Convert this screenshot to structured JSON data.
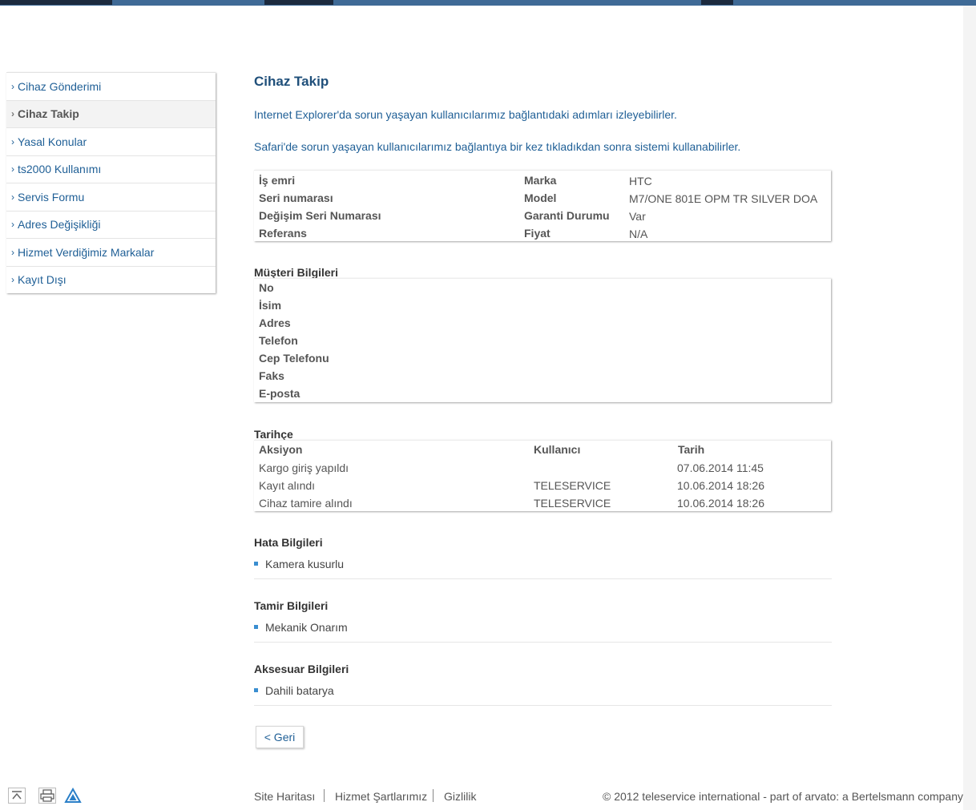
{
  "sidebar": {
    "items": [
      {
        "label": "Cihaz Gönderimi",
        "active": false
      },
      {
        "label": "Cihaz Takip",
        "active": true
      },
      {
        "label": "Yasal Konular",
        "active": false
      },
      {
        "label": "ts2000 Kullanımı",
        "active": false
      },
      {
        "label": "Servis Formu",
        "active": false
      },
      {
        "label": "Adres Değişikliği",
        "active": false
      },
      {
        "label": "Hizmet Verdiğimiz Markalar",
        "active": false
      },
      {
        "label": "Kayıt Dışı",
        "active": false
      }
    ]
  },
  "main": {
    "title": "Cihaz Takip",
    "info_ie": "Internet Explorer'da sorun yaşayan kullanıcılarımız bağlantıdaki adımları izleyebilirler.",
    "info_safari": "Safari'de sorun yaşayan kullanıcılarımız bağlantıya bir kez tıkladıkdan sonra sistemi kullanabilirler."
  },
  "order": {
    "left": [
      {
        "label": "İş emri",
        "value": ""
      },
      {
        "label": "Seri numarası",
        "value": ""
      },
      {
        "label": "Değişim Seri Numarası",
        "value": ""
      },
      {
        "label": "Referans",
        "value": ""
      }
    ],
    "right": [
      {
        "label": "Marka",
        "value": "HTC"
      },
      {
        "label": "Model",
        "value": "M7/ONE 801E OPM TR SILVER DOA"
      },
      {
        "label": "Garanti Durumu",
        "value": "Var"
      },
      {
        "label": "Fiyat",
        "value": "N/A"
      }
    ]
  },
  "customer": {
    "title": "Müşteri Bilgileri",
    "fields": [
      "No",
      "İsim",
      "Adres",
      "Telefon",
      "Cep Telefonu",
      "Faks",
      "E-posta"
    ]
  },
  "history": {
    "title": "Tarihçe",
    "headers": {
      "action": "Aksiyon",
      "user": "Kullanıcı",
      "date": "Tarih"
    },
    "rows": [
      {
        "action": "Kargo giriş yapıldı",
        "user": "",
        "date": "07.06.2014 11:45"
      },
      {
        "action": "Kayıt alındı",
        "user": "TELESERVICE",
        "date": "10.06.2014 18:26"
      },
      {
        "action": "Cihaz tamire alındı",
        "user": "TELESERVICE",
        "date": "10.06.2014 18:26"
      }
    ]
  },
  "fault": {
    "title": "Hata Bilgileri",
    "item": "Kamera kusurlu"
  },
  "repair": {
    "title": "Tamir Bilgileri",
    "item": "Mekanik Onarım"
  },
  "accessory": {
    "title": "Aksesuar Bilgileri",
    "item": "Dahili batarya"
  },
  "back_label": "< Geri",
  "footer": {
    "links": [
      "Site Haritası",
      "Hizmet Şartlarımız",
      "Gizlilik"
    ],
    "copyright": "© 2012 teleservice international - part of arvato: a Bertelsmann company"
  },
  "icons": {
    "top": "scroll-top-icon",
    "print": "print-icon",
    "brand": "brand-logo-icon"
  },
  "colors": {
    "link": "#1f5f96",
    "title": "#1f4f7a",
    "bullet": "#3a8ed0"
  }
}
